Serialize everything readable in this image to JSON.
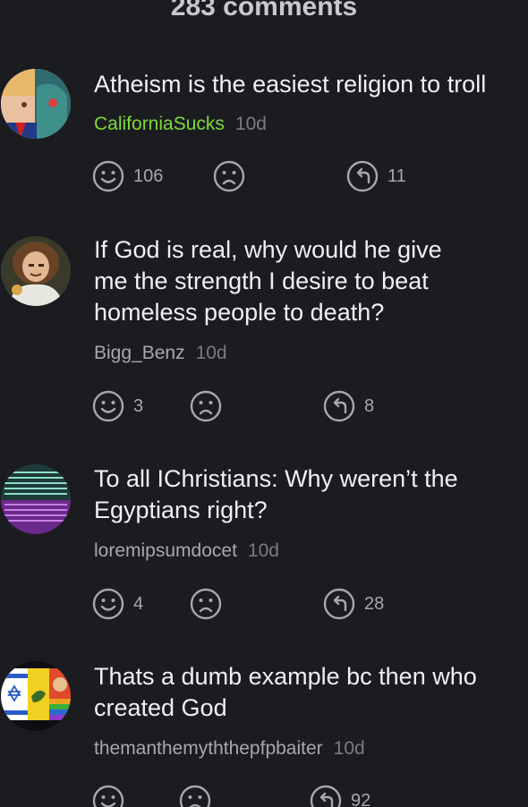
{
  "header": {
    "title": "283 comments"
  },
  "comments": [
    {
      "text_lines": [
        "Atheism is the easiest religion to troll"
      ],
      "author": "CaliforniaSucks",
      "age": "10d",
      "likes": "106",
      "replies": "11",
      "author_color": "#7fd93a"
    },
    {
      "text_lines": [
        "If God is real, why would he give",
        "me the strength I desire to beat",
        "homeless people to death?"
      ],
      "author": "Bigg_Benz",
      "age": "10d",
      "likes": "3",
      "replies": "8"
    },
    {
      "text_lines": [
        "To all IChristians: Why weren’t the",
        "Egyptians right?"
      ],
      "author": "loremipsumdocet",
      "age": "10d",
      "likes": "4",
      "replies": "28"
    },
    {
      "text_lines": [
        "Thats a dumb example bc then who",
        "created God"
      ],
      "author": "themanthemyththepfpbaiter",
      "age": "10d",
      "likes": "",
      "replies": "92"
    }
  ],
  "icons": {
    "like": "smile-face-icon",
    "dislike": "frown-face-icon",
    "reply": "reply-arrow-icon"
  },
  "colors": {
    "background": "#1b1c20",
    "icon": "#a7a7ad",
    "highlight_author": "#7fd93a"
  }
}
